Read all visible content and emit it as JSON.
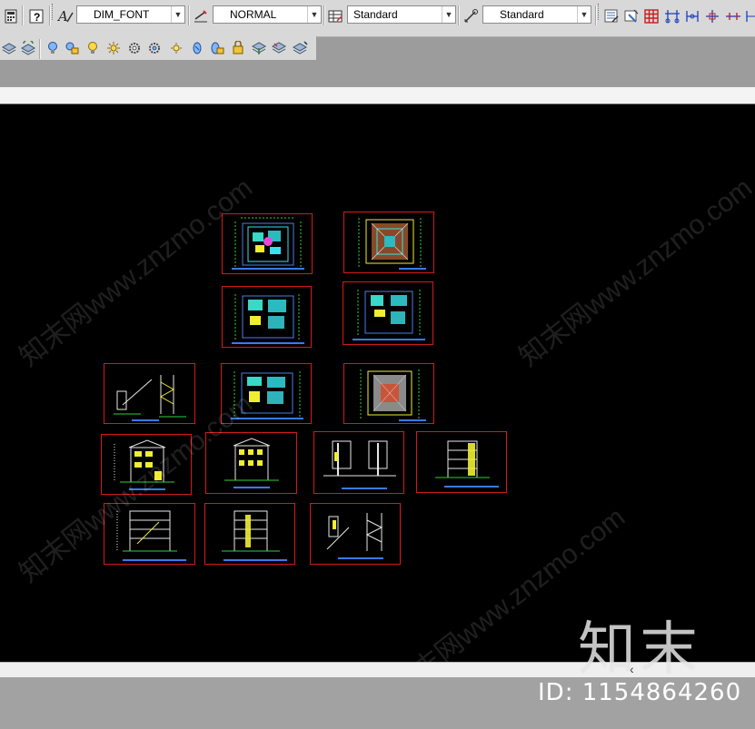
{
  "toolbar": {
    "text_style": {
      "icon": "text-style-icon",
      "value": "DIM_FONT"
    },
    "dim_style": {
      "icon": "dimension-style-icon",
      "value": "NORMAL"
    },
    "table_style": {
      "icon": "table-style-icon",
      "value": "Standard"
    },
    "multileader_style": {
      "icon": "multileader-style-icon",
      "value": "Standard"
    },
    "right_icons": [
      "layer-properties-icon",
      "layer-states-icon",
      "table-grid-icon",
      "dim-linear-icon",
      "dim-aligned-icon",
      "dim-center-icon",
      "dim-baseline-icon"
    ]
  },
  "layer_toolbar": {
    "icons": [
      "layer-stack-icon",
      "layer-previous-icon",
      "bulb-off-icon",
      "lock-icon",
      "bulb-icon",
      "sun-icon",
      "gear-icon",
      "freeze-icon",
      "thaw-icon",
      "isolate-icon",
      "unisolate-icon",
      "lock-layer-icon",
      "layer-merge-icon",
      "layer-delete-icon",
      "layer-walk-icon"
    ]
  },
  "scrollbar": {
    "arrow": "‹"
  },
  "watermark": {
    "text": "知末网www.znzmo.com",
    "brand": "知末",
    "id": "ID: 1154864260"
  },
  "canvas_bg": "#000000",
  "frame_color": "#d41a1a"
}
